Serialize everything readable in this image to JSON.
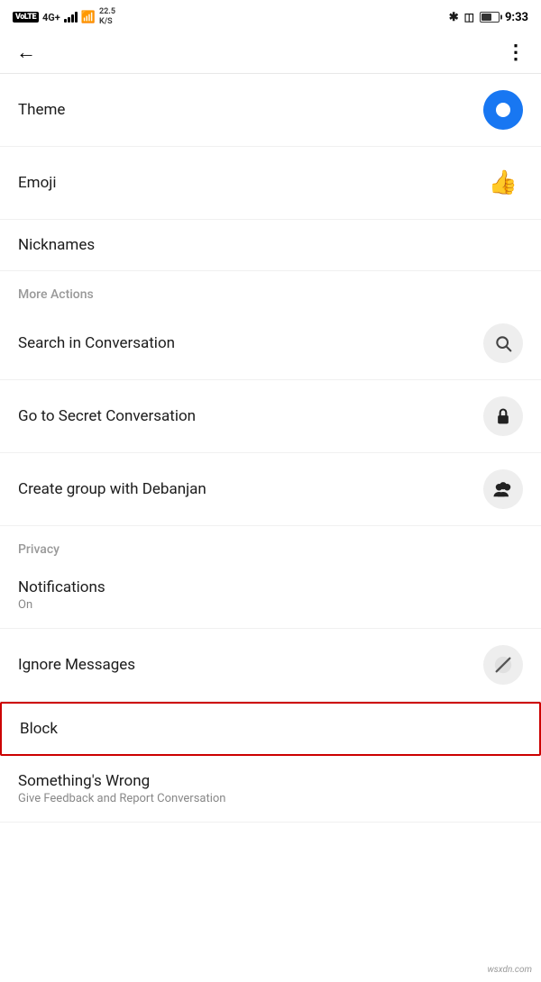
{
  "statusBar": {
    "volte": "VoLTE",
    "signal": "4G",
    "speed": "22.5\nK/S",
    "time": "9:33",
    "battery_percent": "60"
  },
  "navBar": {
    "back_label": "←",
    "more_label": "⋮"
  },
  "sections": {
    "more_actions_label": "More Actions",
    "privacy_label": "Privacy"
  },
  "items": [
    {
      "id": "theme",
      "title": "Theme",
      "subtitle": "",
      "icon": "theme-icon",
      "has_right_icon": true
    },
    {
      "id": "emoji",
      "title": "Emoji",
      "subtitle": "",
      "icon": "emoji-icon",
      "has_right_icon": true
    },
    {
      "id": "nicknames",
      "title": "Nicknames",
      "subtitle": "",
      "icon": "",
      "has_right_icon": false
    },
    {
      "id": "search",
      "title": "Search in Conversation",
      "subtitle": "",
      "icon": "search-icon",
      "has_right_icon": true
    },
    {
      "id": "secret",
      "title": "Go to Secret Conversation",
      "subtitle": "",
      "icon": "lock-icon",
      "has_right_icon": true
    },
    {
      "id": "group",
      "title": "Create group with Debanjan",
      "subtitle": "",
      "icon": "group-icon",
      "has_right_icon": true
    },
    {
      "id": "notifications",
      "title": "Notifications",
      "subtitle": "On",
      "icon": "",
      "has_right_icon": false
    },
    {
      "id": "ignore",
      "title": "Ignore Messages",
      "subtitle": "",
      "icon": "mute-icon",
      "has_right_icon": true
    },
    {
      "id": "block",
      "title": "Block",
      "subtitle": "",
      "icon": "",
      "has_right_icon": false,
      "highlighted": true
    },
    {
      "id": "something_wrong",
      "title": "Something's Wrong",
      "subtitle": "Give Feedback and Report Conversation",
      "icon": "",
      "has_right_icon": false
    }
  ]
}
